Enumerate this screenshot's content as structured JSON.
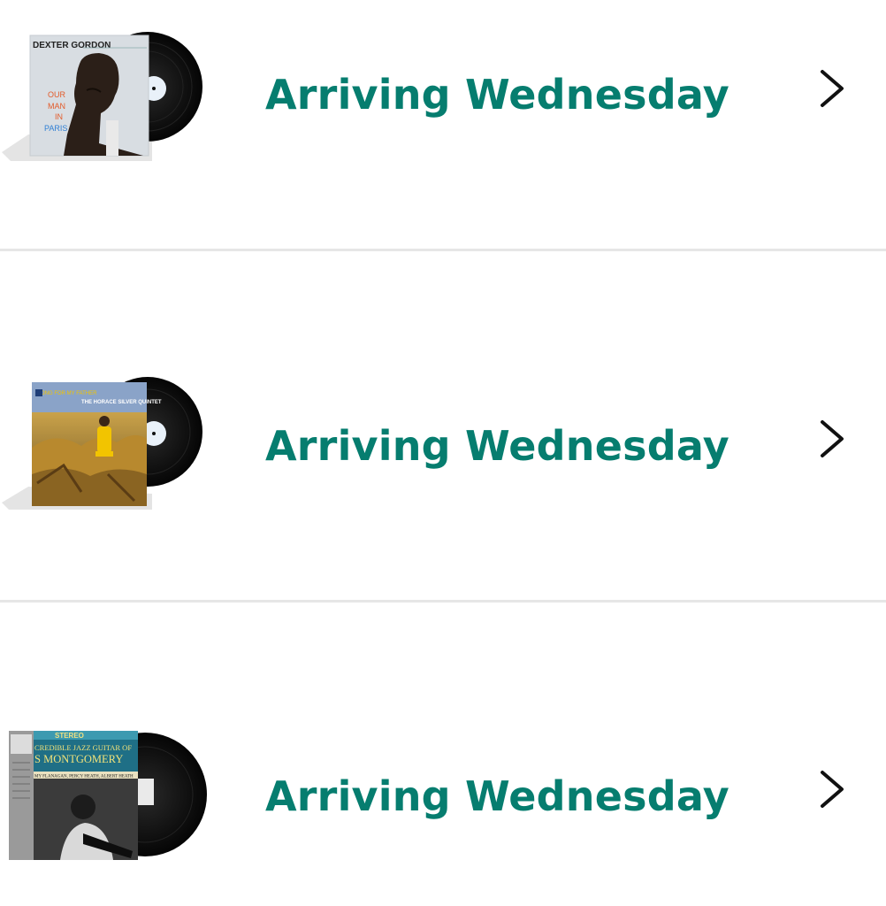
{
  "orders": [
    {
      "status": "Arriving Wednesday",
      "album": {
        "artist": "DEXTER GORDON",
        "title_lines": [
          "OUR",
          "MAN",
          "IN",
          "PARIS"
        ],
        "cover_bg": "#d8dde2",
        "accent": "#2f7fd4"
      }
    },
    {
      "status": "Arriving Wednesday",
      "album": {
        "artist": "THE HORACE SILVER QUINTET",
        "cover_bg": "#6e5a2a",
        "accent": "#f2c400"
      }
    },
    {
      "status": "Arriving Wednesday",
      "album": {
        "banner": "STEREO",
        "headline": "CREDIBLE JAZZ GUITAR OF",
        "artist": "S MONTGOMERY",
        "sidemen": "MY FLANAGAN, PERCY HEATH, ALBERT HEATH",
        "cover_bg": "#2a2a2a",
        "accent": "#3d9ab0"
      }
    }
  ],
  "colors": {
    "status_text": "#067d6f",
    "chevron": "#111111",
    "divider": "#e6e6e6",
    "record": "#0d0d0d"
  }
}
